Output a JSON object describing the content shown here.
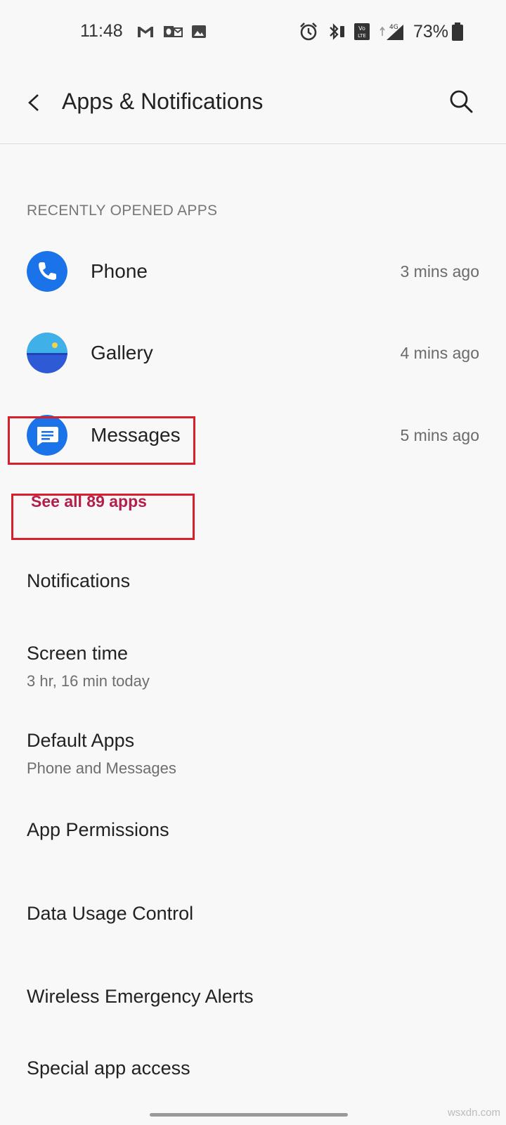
{
  "status_bar": {
    "time": "11:48",
    "battery_percent": "73%",
    "network": "4G",
    "volte": "Vo LTE",
    "icons": [
      "gmail-icon",
      "outlook-icon",
      "gallery-icon",
      "alarm-icon",
      "bluetooth-icon",
      "volte-icon",
      "signal-icon",
      "battery-icon"
    ]
  },
  "toolbar": {
    "title": "Apps & Notifications",
    "back_icon": "back-arrow-icon",
    "search_icon": "search-icon"
  },
  "recent_apps": {
    "header": "RECENTLY OPENED APPS",
    "items": [
      {
        "name": "Phone",
        "time": "3 mins ago",
        "icon": "phone-app-icon"
      },
      {
        "name": "Gallery",
        "time": "4 mins ago",
        "icon": "gallery-app-icon"
      },
      {
        "name": "Messages",
        "time": "5 mins ago",
        "icon": "messages-app-icon"
      }
    ],
    "see_all": "See all 89 apps"
  },
  "menu": [
    {
      "title": "Notifications",
      "subtitle": ""
    },
    {
      "title": "Screen time",
      "subtitle": "3 hr, 16 min today"
    },
    {
      "title": "Default Apps",
      "subtitle": "Phone and Messages"
    },
    {
      "title": "App Permissions",
      "subtitle": ""
    },
    {
      "title": "Data Usage Control",
      "subtitle": ""
    },
    {
      "title": "Wireless Emergency Alerts",
      "subtitle": ""
    },
    {
      "title": "Special app access",
      "subtitle": ""
    }
  ],
  "watermark": "wsxdn.com",
  "colors": {
    "accent": "#b41e4a",
    "highlight": "#d8202c",
    "phone_blue": "#1a73e8",
    "background": "#f8f8f8"
  }
}
